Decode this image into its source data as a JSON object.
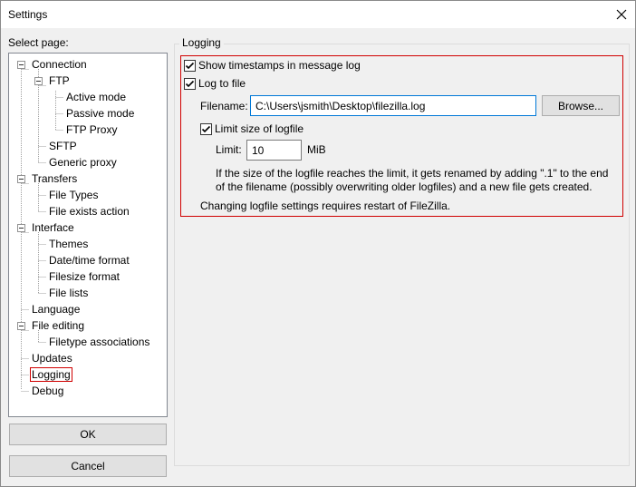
{
  "window": {
    "title": "Settings"
  },
  "left_panel": {
    "label": "Select page:",
    "tree": [
      {
        "label": "Connection",
        "level": 0,
        "expander": "minus"
      },
      {
        "label": "FTP",
        "level": 1,
        "expander": "minus"
      },
      {
        "label": "Active mode",
        "level": 2
      },
      {
        "label": "Passive mode",
        "level": 2
      },
      {
        "label": "FTP Proxy",
        "level": 2
      },
      {
        "label": "SFTP",
        "level": 1
      },
      {
        "label": "Generic proxy",
        "level": 1
      },
      {
        "label": "Transfers",
        "level": 0,
        "expander": "minus"
      },
      {
        "label": "File Types",
        "level": 1
      },
      {
        "label": "File exists action",
        "level": 1
      },
      {
        "label": "Interface",
        "level": 0,
        "expander": "minus"
      },
      {
        "label": "Themes",
        "level": 1
      },
      {
        "label": "Date/time format",
        "level": 1
      },
      {
        "label": "Filesize format",
        "level": 1
      },
      {
        "label": "File lists",
        "level": 1
      },
      {
        "label": "Language",
        "level": 0
      },
      {
        "label": "File editing",
        "level": 0,
        "expander": "minus"
      },
      {
        "label": "Filetype associations",
        "level": 1
      },
      {
        "label": "Updates",
        "level": 0
      },
      {
        "label": "Logging",
        "level": 0,
        "selected": true
      },
      {
        "label": "Debug",
        "level": 0
      }
    ],
    "ok_label": "OK",
    "cancel_label": "Cancel"
  },
  "logging": {
    "group_label": "Logging",
    "show_timestamps_label": "Show timestamps in message log",
    "show_timestamps_checked": true,
    "log_to_file_label": "Log to file",
    "log_to_file_checked": true,
    "filename_label": "Filename:",
    "filename_value": "C:\\Users\\jsmith\\Desktop\\filezilla.log",
    "browse_label": "Browse...",
    "limit_size_label": "Limit size of logfile",
    "limit_size_checked": true,
    "limit_label": "Limit:",
    "limit_value": "10",
    "limit_unit": "MiB",
    "info_line1": "If the size of the logfile reaches the limit, it gets renamed by adding \".1\" to the end",
    "info_line2": "of the filename (possibly overwriting older logfiles) and a new file gets created.",
    "restart_note": "Changing logfile settings requires restart of FileZilla."
  },
  "colors": {
    "highlight_frame": "#d00000",
    "focus_border": "#0078d7"
  }
}
